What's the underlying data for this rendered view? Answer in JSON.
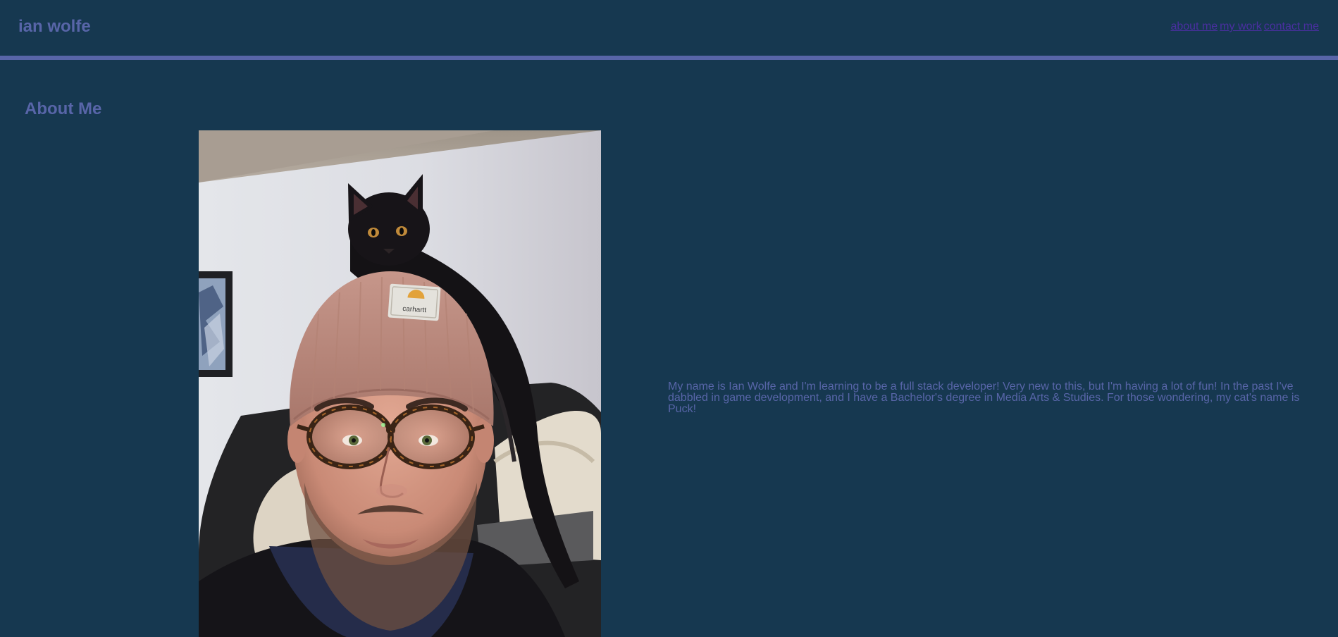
{
  "header": {
    "site_title": "ian wolfe",
    "nav": [
      {
        "label": "about me"
      },
      {
        "label": "my work"
      },
      {
        "label": "contact me"
      }
    ]
  },
  "about": {
    "heading": "About Me",
    "bio": "My name is Ian Wolfe and I'm learning to be a full stack developer! Very new to this, but I'm having a lot of fun! In the past I've dabbled in game development, and I have a Bachelor's degree in Media Arts & Studies. For those wondering, my cat's name is Puck!",
    "beanie_patch_text": "carhartt"
  },
  "colors": {
    "background": "#163850",
    "accent": "#5865a8",
    "link": "#4a2fa0"
  }
}
